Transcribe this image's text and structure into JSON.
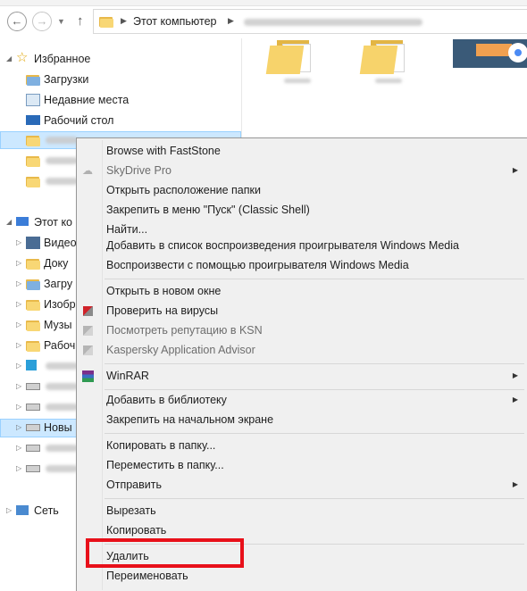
{
  "address": {
    "crumb": "Этот компьютер"
  },
  "nav": {
    "favorites_label": "Избранное",
    "favorites": [
      {
        "label": "Загрузки"
      },
      {
        "label": "Недавние места"
      },
      {
        "label": "Рабочий стол"
      }
    ],
    "computer_label": "Этот ко",
    "computer_items": [
      {
        "label": "Видео"
      },
      {
        "label": "Доку"
      },
      {
        "label": "Загру"
      },
      {
        "label": "Изобр"
      },
      {
        "label": "Музы"
      },
      {
        "label": "Рабоч"
      },
      {
        "label": "Новы"
      }
    ],
    "network_label": "Сеть"
  },
  "menu": {
    "items": [
      {
        "label": "Browse with FastStone"
      },
      {
        "label": "SkyDrive Pro"
      },
      {
        "label": "Открыть расположение папки"
      },
      {
        "label": "Закрепить в меню \"Пуск\" (Classic Shell)"
      },
      {
        "label": "Найти..."
      },
      {
        "label": "Добавить в список воспроизведения проигрывателя Windows Media"
      },
      {
        "label": "Воспроизвести с помощью проигрывателя Windows Media"
      },
      {
        "label": "Открыть в новом окне"
      },
      {
        "label": "Проверить на вирусы"
      },
      {
        "label": "Посмотреть репутацию в KSN"
      },
      {
        "label": "Kaspersky Application Advisor"
      },
      {
        "label": "WinRAR"
      },
      {
        "label": "Добавить в библиотеку"
      },
      {
        "label": "Закрепить на начальном экране"
      },
      {
        "label": "Копировать в папку..."
      },
      {
        "label": "Переместить в папку..."
      },
      {
        "label": "Отправить"
      },
      {
        "label": "Вырезать"
      },
      {
        "label": "Копировать"
      },
      {
        "label": "Удалить"
      },
      {
        "label": "Переименовать"
      }
    ]
  },
  "colors": {
    "highlight_box": "#e8101a",
    "selection": "#cce8ff"
  }
}
